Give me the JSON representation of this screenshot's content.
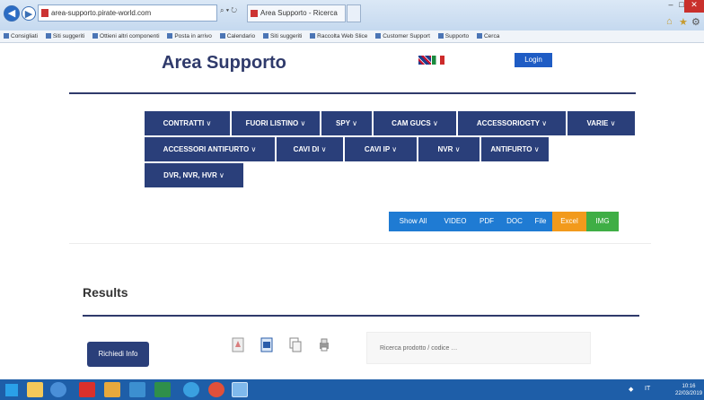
{
  "browser": {
    "address": "area-supporto.pirate-world.com",
    "address_tools": "⌕ ▾ ↻",
    "tab_title": "Area Supporto - Ricerca"
  },
  "favorites": [
    "Consigliati",
    "Siti suggeriti",
    "Ottieni altri componenti",
    "Posta in arrivo",
    "Calendario",
    "Siti suggeriti",
    "Raccolta Web Slice",
    "Customer Support",
    "Supporto",
    "Cerca"
  ],
  "site": {
    "title": "Area Supporto",
    "login_label": "Login"
  },
  "menu": [
    {
      "label": "CONTRATTI",
      "caret": "∨"
    },
    {
      "label": "FUORI LISTINO",
      "caret": "∨"
    },
    {
      "label": "SPY",
      "caret": "∨"
    },
    {
      "label": "CAM GUCS",
      "caret": "∨"
    },
    {
      "label": "ACCESSORIOGTY",
      "caret": "∨"
    },
    {
      "label": "VARIE",
      "caret": "∨"
    },
    {
      "label": "ACCESSORI ANTIFURTO",
      "caret": "∨"
    },
    {
      "label": "CAVI DI",
      "caret": "∨"
    },
    {
      "label": "CAVI IP",
      "caret": "∨"
    },
    {
      "label": "NVR",
      "caret": "∨"
    },
    {
      "label": "ANTIFURTO",
      "caret": "∨"
    },
    {
      "label": "DVR, NVR, HVR",
      "caret": "∨"
    }
  ],
  "filters": [
    "Show All",
    "VIDEO",
    "PDF",
    "DOC",
    "File",
    "Excel",
    "IMG"
  ],
  "results": {
    "heading": "Results",
    "action_label": "Richiedi Info",
    "search_text": "Ricerca prodotto / codice …"
  },
  "colors": {
    "navy": "#2a3f7a",
    "filter_blue": "#1f7bd3",
    "filter_orange": "#f29a1c",
    "filter_green": "#3fae45",
    "taskbar": "#1e5ea8"
  },
  "icons": {
    "pdf": "pdf-icon",
    "word": "word-doc-icon",
    "copy": "copy-icon",
    "print": "print-icon"
  },
  "taskbar": {
    "tray_text": "IT",
    "clock_time": "10:16",
    "clock_date": "22/03/2019"
  }
}
